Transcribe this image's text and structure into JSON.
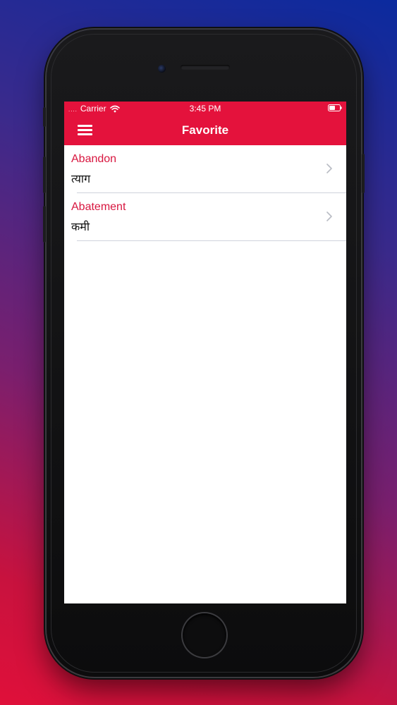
{
  "status_bar": {
    "signal": "....",
    "carrier": "Carrier",
    "time": "3:45 PM"
  },
  "nav": {
    "title": "Favorite",
    "menu_icon": "hamburger-menu-icon"
  },
  "favorites": [
    {
      "word": "Abandon",
      "meaning": "त्याग"
    },
    {
      "word": "Abatement",
      "meaning": "कमी"
    }
  ],
  "colors": {
    "accent": "#e4123c",
    "word_text": "#d8163f",
    "meaning_text": "#111111"
  }
}
